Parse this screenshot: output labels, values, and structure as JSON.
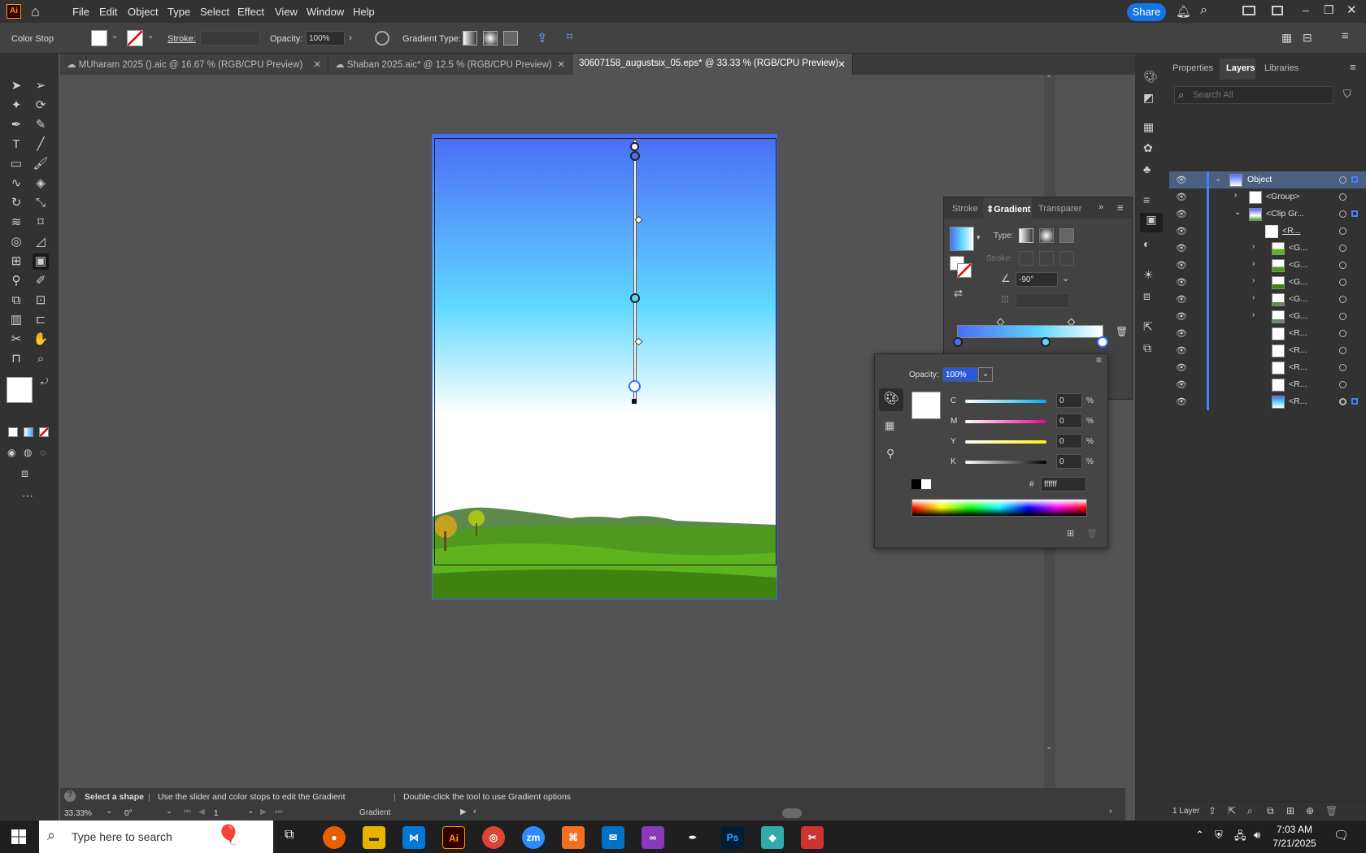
{
  "menubar": {
    "items": [
      "File",
      "Edit",
      "Object",
      "Type",
      "Select",
      "Effect",
      "View",
      "Window",
      "Help"
    ],
    "share_label": "Share",
    "app_logo": "Ai"
  },
  "ctrlbar": {
    "context_label": "Color Stop",
    "stroke_label": "Stroke:",
    "opacity_label": "Opacity:",
    "opacity_value": "100%",
    "gradient_type_label": "Gradient Type:"
  },
  "tabs": [
    {
      "label": "MUharam 2025 ().aic @ 16.67 % (RGB/CPU Preview)"
    },
    {
      "label": "Shaban 2025.aic* @ 12.5 % (RGB/CPU Preview)"
    },
    {
      "label": "30607158_augustsix_05.eps* @ 33.33 % (RGB/CPU Preview)"
    }
  ],
  "gradient_panel": {
    "tabs": [
      "Stroke",
      "Gradient",
      "Transparer"
    ],
    "type_label": "Type:",
    "stroke_label": "Stroke:",
    "angle_value": "-90°"
  },
  "color_panel": {
    "opacity_label": "Opacity:",
    "opacity_value": "100%",
    "channels": [
      {
        "name": "C",
        "value": "0"
      },
      {
        "name": "M",
        "value": "0"
      },
      {
        "name": "Y",
        "value": "0"
      },
      {
        "name": "K",
        "value": "0"
      }
    ],
    "percent": "%",
    "hex_label": "#",
    "hex_value": "ffffff"
  },
  "layers_panel": {
    "tabs": [
      "Properties",
      "Layers",
      "Libraries"
    ],
    "search_placeholder": "Search All",
    "rows": [
      "Object",
      "<Group>",
      "<Clip Gr...",
      "<R...",
      "<G...",
      "<G...",
      "<G...",
      "<G...",
      "<G...",
      "<R...",
      "<R...",
      "<R...",
      "<R...",
      "<R..."
    ],
    "footer": "1 Layer"
  },
  "status": {
    "hint_1": "Select a shape",
    "hint_2": "Use the slider and color stops to edit the Gradient",
    "hint_3": "Double-click the tool to use Gradient options",
    "zoom": "33.33%",
    "rotation": "0°",
    "artboard": "1",
    "tool_name": "Gradient"
  },
  "taskbar": {
    "search_placeholder": "Type here to search",
    "time": "7:03 AM",
    "date": "7/21/2025"
  }
}
